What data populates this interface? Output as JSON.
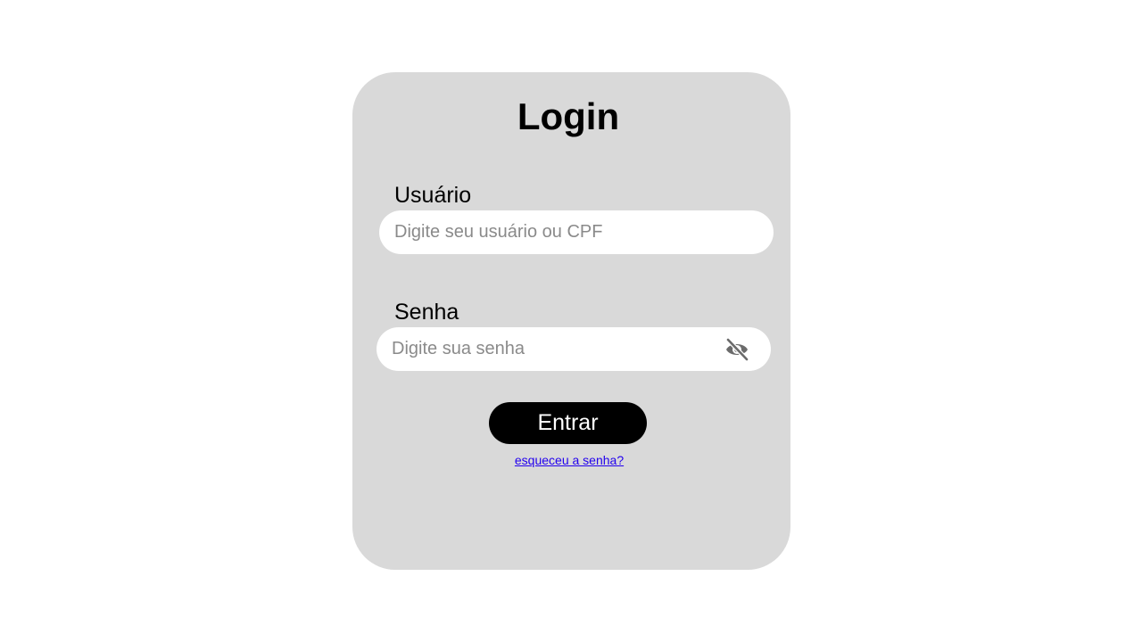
{
  "login": {
    "title": "Login",
    "user_label": "Usuário",
    "user_placeholder": "Digite seu usuário ou CPF",
    "user_value": "",
    "password_label": "Senha",
    "password_placeholder": "Digite sua senha",
    "password_value": "",
    "password_visibility_icon": "eye-off-icon",
    "submit_label": "Entrar",
    "forgot_link": "esqueceu a senha?"
  },
  "colors": {
    "page_background": "#ffffff",
    "card_background": "#d9d9d9",
    "input_background": "#ffffff",
    "button_background": "#000000",
    "button_text": "#ffffff",
    "link": "#2200ee",
    "placeholder": "#8a8a8a",
    "icon": "#6b6b6b"
  }
}
